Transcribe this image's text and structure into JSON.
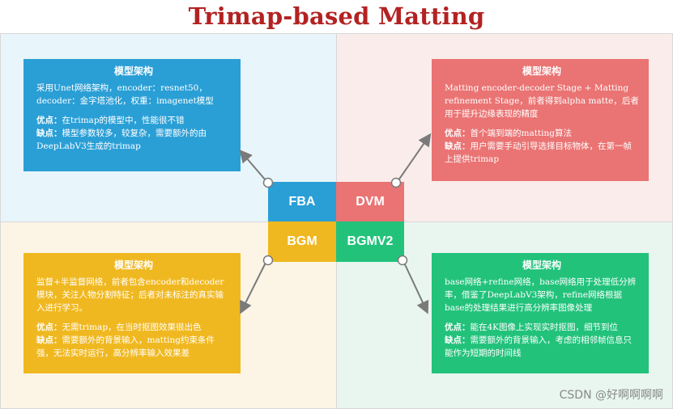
{
  "title": "Trimap-based Matting",
  "tiles": {
    "fba": "FBA",
    "dvm": "DVM",
    "bgm": "BGM",
    "bgmv2": "BGMV2"
  },
  "cards": {
    "fba": {
      "heading": "模型架构",
      "description": "采用Unet网络架构，encoder：resnet50，decoder：金字塔池化，权重：imagenet模型",
      "pros_label": "优点：",
      "pros": "在trimap的模型中，性能很不错",
      "cons_label": "缺点：",
      "cons": "模型参数较多，较复杂，需要额外的由DeepLabV3生成的trimap"
    },
    "dvm": {
      "heading": "模型架构",
      "description": "Matting encoder-decoder Stage + Matting refinement Stage，前者得到alpha matte，后者用于提升边缘表现的精度",
      "pros_label": "优点：",
      "pros": "首个端到端的matting算法",
      "cons_label": "缺点：",
      "cons": "用户需要手动引导选择目标物体，在第一帧上提供trimap"
    },
    "bgm": {
      "heading": "模型架构",
      "description": "监督+半监督网络，前者包含encoder和decoder模块，关注人物分割特征；后者对未标注的真实输入进行学习。",
      "pros_label": "优点：",
      "pros": "无需trimap，在当时抠图效果很出色",
      "cons_label": "缺点：",
      "cons": "需要额外的背景输入，matting约束条件强，无法实时运行，高分辨率输入效果差"
    },
    "bgmv2": {
      "heading": "模型架构",
      "description": "base网络+refine网络，base网络用于处理低分辨率，借鉴了DeepLabV3架构，refine网络根据base的处理结果进行高分辨率图像处理",
      "pros_label": "优点：",
      "pros": "能在4K图像上实现实时抠图，细节到位",
      "cons_label": "缺点：",
      "cons": "需要额外的背景输入，考虑的相邻帧信息只能作为短期的时间线"
    }
  },
  "watermark": "CSDN @好啊啊啊啊",
  "colors": {
    "title": "#b32222",
    "fba": "#2a9fd6",
    "dvm": "#ea7373",
    "bgm": "#f0b820",
    "bgmv2": "#22c27b",
    "bg_fba": "#e8f5fb",
    "bg_dvm": "#fbecec",
    "bg_bgm": "#fcf5e6",
    "bg_bgmv2": "#e8f6ef",
    "connector": "#7a7a7a"
  }
}
